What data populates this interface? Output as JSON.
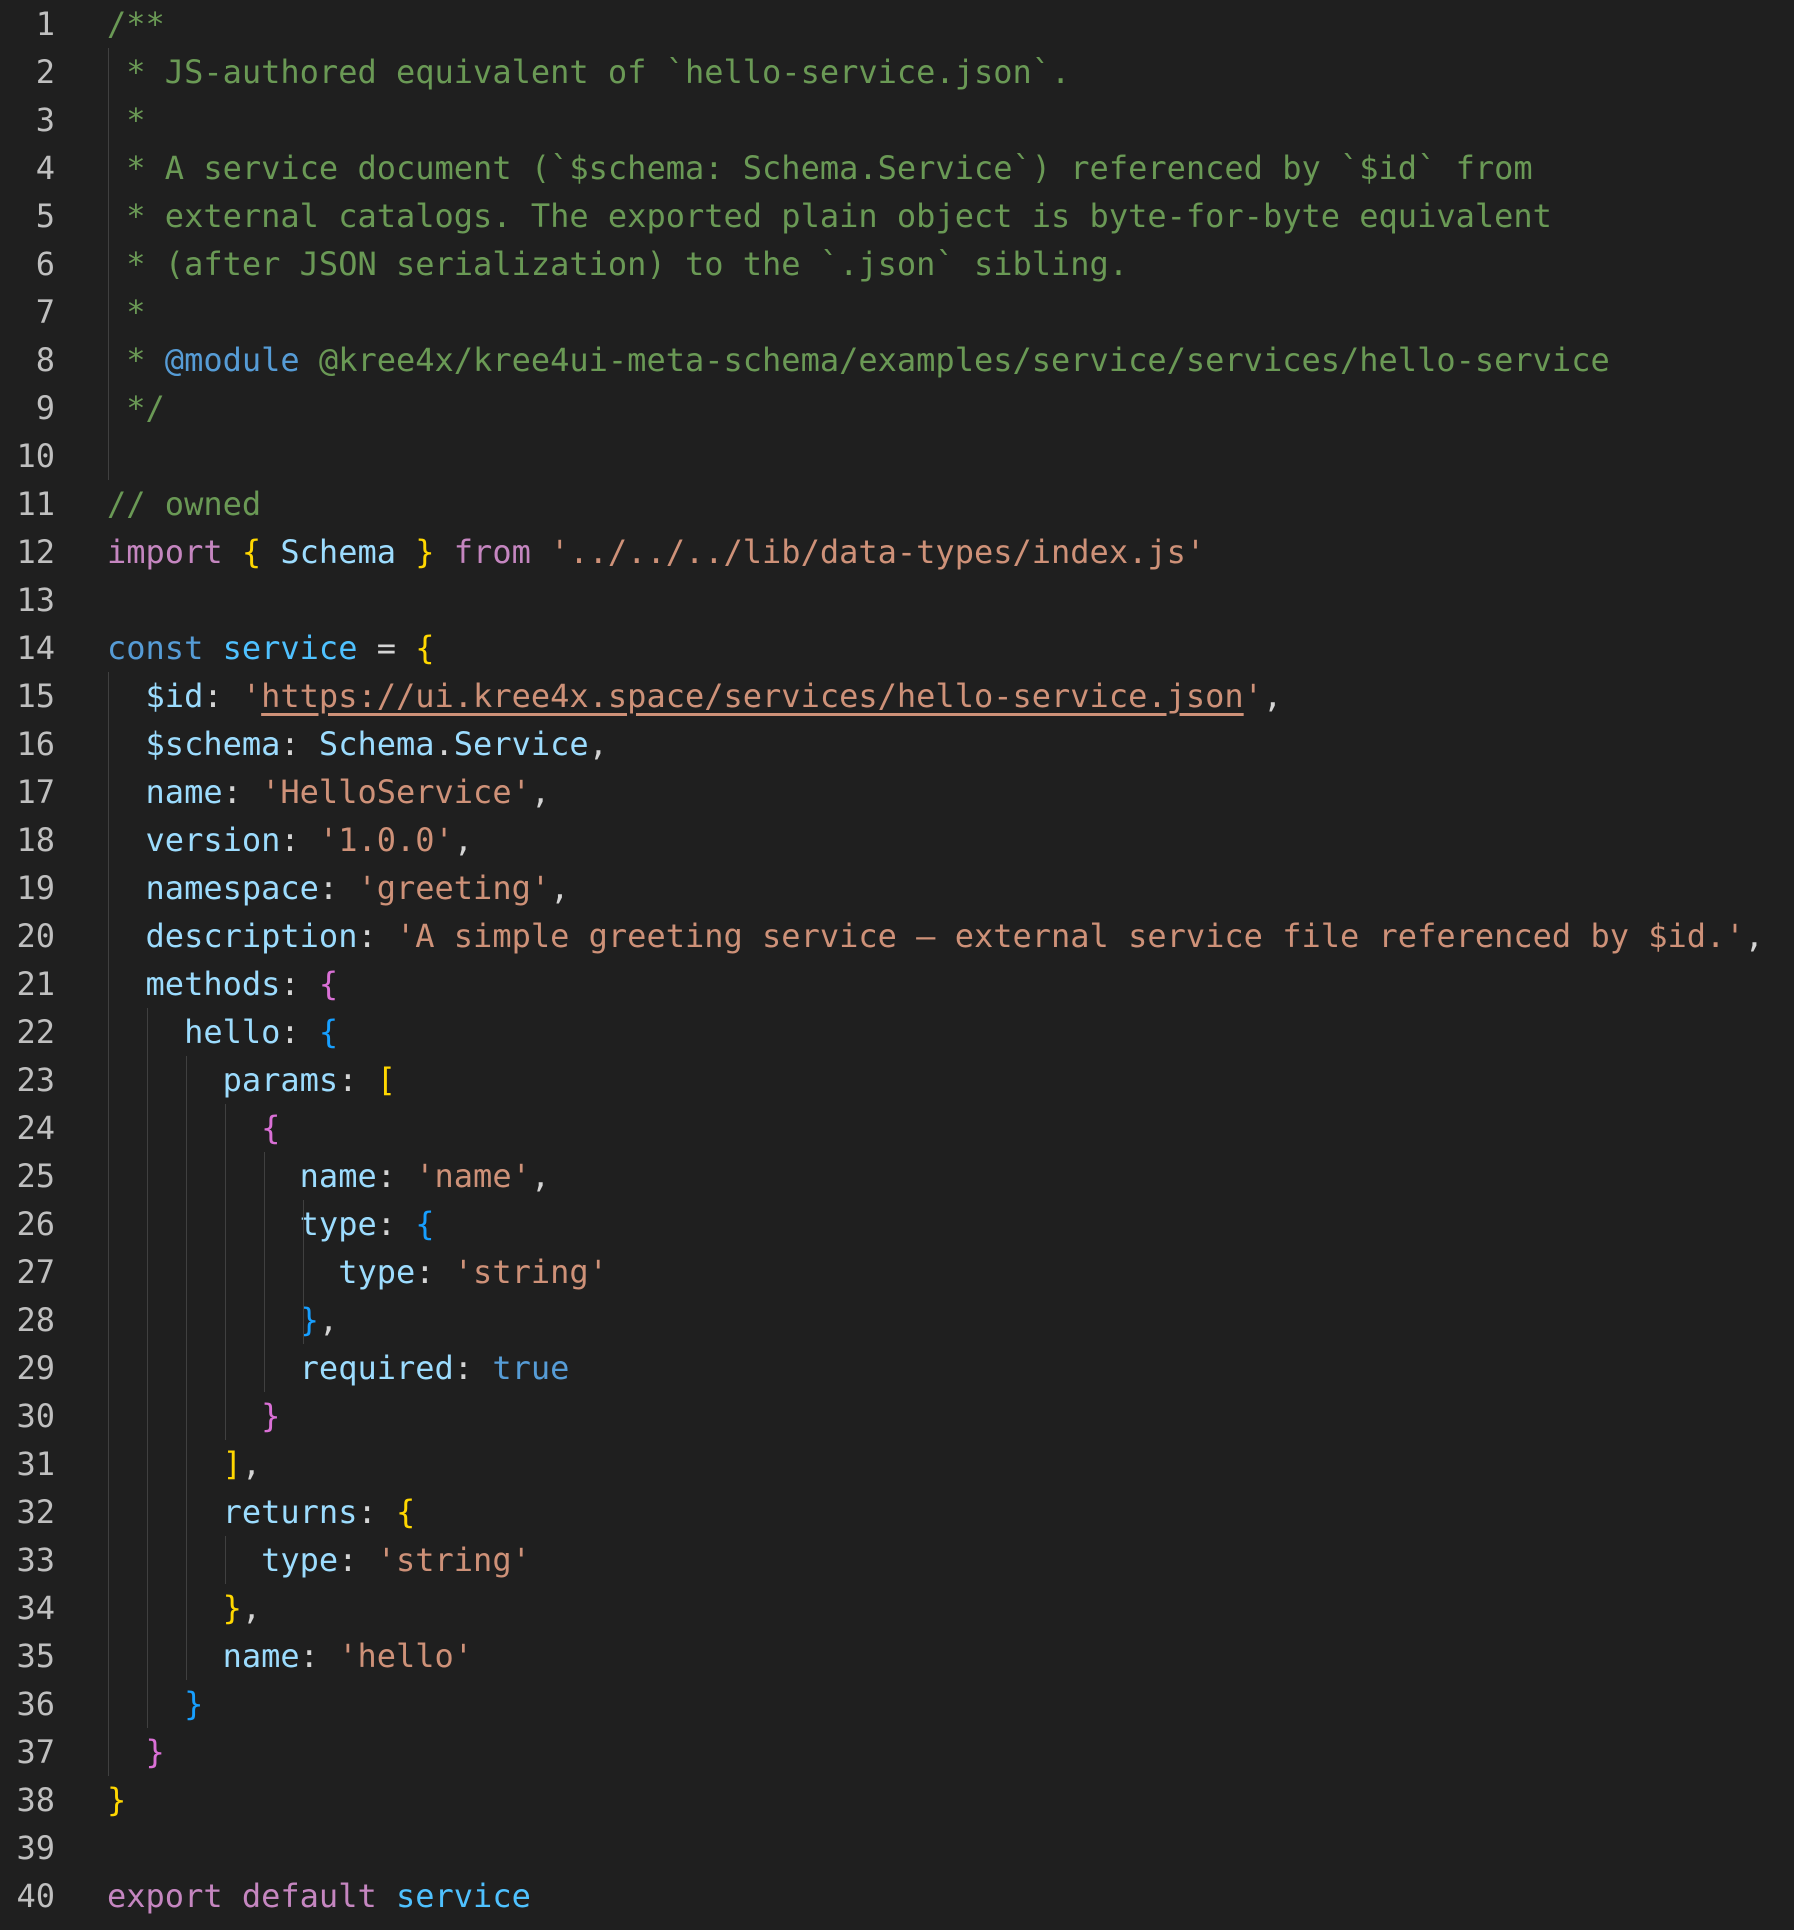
{
  "editor": {
    "language": "javascript",
    "line_numbers": [
      "1",
      "2",
      "3",
      "4",
      "5",
      "6",
      "7",
      "8",
      "9",
      "10",
      "11",
      "12",
      "13",
      "14",
      "15",
      "16",
      "17",
      "18",
      "19",
      "20",
      "21",
      "22",
      "23",
      "24",
      "25",
      "26",
      "27",
      "28",
      "29",
      "30",
      "31",
      "32",
      "33",
      "34",
      "35",
      "36",
      "37",
      "38",
      "39",
      "40"
    ],
    "colors": {
      "background": "#1f1f1f",
      "comment": "#6a9955",
      "keyword": "#c586c0",
      "string": "#ce9178",
      "property": "#9cdcfe",
      "bracket_level1": "#ffd700",
      "bracket_level2": "#da70d6",
      "bracket_level3": "#179fff"
    },
    "lines": [
      [
        {
          "c": "t-comment",
          "t": "/**"
        }
      ],
      [
        {
          "c": "t-comment",
          "t": " * JS-authored equivalent of `hello-service.json`."
        }
      ],
      [
        {
          "c": "t-comment",
          "t": " *"
        }
      ],
      [
        {
          "c": "t-comment",
          "t": " * A service document (`$schema: Schema.Service`) referenced by `$id` from"
        }
      ],
      [
        {
          "c": "t-comment",
          "t": " * external catalogs. The exported plain object is byte-for-byte equivalent"
        }
      ],
      [
        {
          "c": "t-comment",
          "t": " * (after JSON serialization) to the `.json` sibling."
        }
      ],
      [
        {
          "c": "t-comment",
          "t": " *"
        }
      ],
      [
        {
          "c": "t-comment",
          "t": " * "
        },
        {
          "c": "t-tag",
          "t": "@module"
        },
        {
          "c": "t-comment",
          "t": " @kree4x/kree4ui-meta-schema/examples/service/services/hello-service"
        }
      ],
      [
        {
          "c": "t-comment",
          "t": " */"
        }
      ],
      [],
      [
        {
          "c": "t-comment",
          "t": "// owned"
        }
      ],
      [
        {
          "c": "t-keyword",
          "t": "import"
        },
        {
          "c": "t-plain",
          "t": " "
        },
        {
          "c": "b-yellow",
          "t": "{"
        },
        {
          "c": "t-plain",
          "t": " "
        },
        {
          "c": "t-type",
          "t": "Schema"
        },
        {
          "c": "t-plain",
          "t": " "
        },
        {
          "c": "b-yellow",
          "t": "}"
        },
        {
          "c": "t-plain",
          "t": " "
        },
        {
          "c": "t-keyword",
          "t": "from"
        },
        {
          "c": "t-plain",
          "t": " "
        },
        {
          "c": "t-string",
          "t": "'../../../lib/data-types/index.js'"
        }
      ],
      [],
      [
        {
          "c": "t-storage",
          "t": "const"
        },
        {
          "c": "t-plain",
          "t": " "
        },
        {
          "c": "t-var",
          "t": "service"
        },
        {
          "c": "t-plain",
          "t": " = "
        },
        {
          "c": "b-yellow",
          "t": "{"
        }
      ],
      [
        {
          "c": "t-plain",
          "t": "  "
        },
        {
          "c": "t-prop",
          "t": "$id"
        },
        {
          "c": "t-plain",
          "t": ": "
        },
        {
          "c": "t-string",
          "t": "'"
        },
        {
          "c": "t-url",
          "t": "https://ui.kree4x.space/services/hello-service.json"
        },
        {
          "c": "t-string",
          "t": "'"
        },
        {
          "c": "t-plain",
          "t": ","
        }
      ],
      [
        {
          "c": "t-plain",
          "t": "  "
        },
        {
          "c": "t-prop",
          "t": "$schema"
        },
        {
          "c": "t-plain",
          "t": ": "
        },
        {
          "c": "t-type",
          "t": "Schema"
        },
        {
          "c": "t-plain",
          "t": "."
        },
        {
          "c": "t-type",
          "t": "Service"
        },
        {
          "c": "t-plain",
          "t": ","
        }
      ],
      [
        {
          "c": "t-plain",
          "t": "  "
        },
        {
          "c": "t-prop",
          "t": "name"
        },
        {
          "c": "t-plain",
          "t": ": "
        },
        {
          "c": "t-string",
          "t": "'HelloService'"
        },
        {
          "c": "t-plain",
          "t": ","
        }
      ],
      [
        {
          "c": "t-plain",
          "t": "  "
        },
        {
          "c": "t-prop",
          "t": "version"
        },
        {
          "c": "t-plain",
          "t": ": "
        },
        {
          "c": "t-string",
          "t": "'1.0.0'"
        },
        {
          "c": "t-plain",
          "t": ","
        }
      ],
      [
        {
          "c": "t-plain",
          "t": "  "
        },
        {
          "c": "t-prop",
          "t": "namespace"
        },
        {
          "c": "t-plain",
          "t": ": "
        },
        {
          "c": "t-string",
          "t": "'greeting'"
        },
        {
          "c": "t-plain",
          "t": ","
        }
      ],
      [
        {
          "c": "t-plain",
          "t": "  "
        },
        {
          "c": "t-prop",
          "t": "description"
        },
        {
          "c": "t-plain",
          "t": ": "
        },
        {
          "c": "t-string",
          "t": "'A simple greeting service — external service file referenced by $id.'"
        },
        {
          "c": "t-plain",
          "t": ","
        }
      ],
      [
        {
          "c": "t-plain",
          "t": "  "
        },
        {
          "c": "t-prop",
          "t": "methods"
        },
        {
          "c": "t-plain",
          "t": ": "
        },
        {
          "c": "b-magenta",
          "t": "{"
        }
      ],
      [
        {
          "c": "t-plain",
          "t": "    "
        },
        {
          "c": "t-prop",
          "t": "hello"
        },
        {
          "c": "t-plain",
          "t": ": "
        },
        {
          "c": "b-blue",
          "t": "{"
        }
      ],
      [
        {
          "c": "t-plain",
          "t": "      "
        },
        {
          "c": "t-prop",
          "t": "params"
        },
        {
          "c": "t-plain",
          "t": ": "
        },
        {
          "c": "b-yellow",
          "t": "["
        }
      ],
      [
        {
          "c": "t-plain",
          "t": "        "
        },
        {
          "c": "b-magenta",
          "t": "{"
        }
      ],
      [
        {
          "c": "t-plain",
          "t": "          "
        },
        {
          "c": "t-prop",
          "t": "name"
        },
        {
          "c": "t-plain",
          "t": ": "
        },
        {
          "c": "t-string",
          "t": "'name'"
        },
        {
          "c": "t-plain",
          "t": ","
        }
      ],
      [
        {
          "c": "t-plain",
          "t": "          "
        },
        {
          "c": "t-prop",
          "t": "type"
        },
        {
          "c": "t-plain",
          "t": ": "
        },
        {
          "c": "b-blue",
          "t": "{"
        }
      ],
      [
        {
          "c": "t-plain",
          "t": "            "
        },
        {
          "c": "t-prop",
          "t": "type"
        },
        {
          "c": "t-plain",
          "t": ": "
        },
        {
          "c": "t-string",
          "t": "'string'"
        }
      ],
      [
        {
          "c": "t-plain",
          "t": "          "
        },
        {
          "c": "b-blue",
          "t": "}"
        },
        {
          "c": "t-plain",
          "t": ","
        }
      ],
      [
        {
          "c": "t-plain",
          "t": "          "
        },
        {
          "c": "t-prop",
          "t": "required"
        },
        {
          "c": "t-plain",
          "t": ": "
        },
        {
          "c": "t-bool",
          "t": "true"
        }
      ],
      [
        {
          "c": "t-plain",
          "t": "        "
        },
        {
          "c": "b-magenta",
          "t": "}"
        }
      ],
      [
        {
          "c": "t-plain",
          "t": "      "
        },
        {
          "c": "b-yellow",
          "t": "]"
        },
        {
          "c": "t-plain",
          "t": ","
        }
      ],
      [
        {
          "c": "t-plain",
          "t": "      "
        },
        {
          "c": "t-prop",
          "t": "returns"
        },
        {
          "c": "t-plain",
          "t": ": "
        },
        {
          "c": "b-yellow",
          "t": "{"
        }
      ],
      [
        {
          "c": "t-plain",
          "t": "        "
        },
        {
          "c": "t-prop",
          "t": "type"
        },
        {
          "c": "t-plain",
          "t": ": "
        },
        {
          "c": "t-string",
          "t": "'string'"
        }
      ],
      [
        {
          "c": "t-plain",
          "t": "      "
        },
        {
          "c": "b-yellow",
          "t": "}"
        },
        {
          "c": "t-plain",
          "t": ","
        }
      ],
      [
        {
          "c": "t-plain",
          "t": "      "
        },
        {
          "c": "t-prop",
          "t": "name"
        },
        {
          "c": "t-plain",
          "t": ": "
        },
        {
          "c": "t-string",
          "t": "'hello'"
        }
      ],
      [
        {
          "c": "t-plain",
          "t": "    "
        },
        {
          "c": "b-blue",
          "t": "}"
        }
      ],
      [
        {
          "c": "t-plain",
          "t": "  "
        },
        {
          "c": "b-magenta",
          "t": "}"
        }
      ],
      [
        {
          "c": "b-yellow",
          "t": "}"
        }
      ],
      [],
      [
        {
          "c": "t-keyword",
          "t": "export"
        },
        {
          "c": "t-plain",
          "t": " "
        },
        {
          "c": "t-keyword",
          "t": "default"
        },
        {
          "c": "t-plain",
          "t": " "
        },
        {
          "c": "t-var",
          "t": "service"
        }
      ]
    ]
  }
}
